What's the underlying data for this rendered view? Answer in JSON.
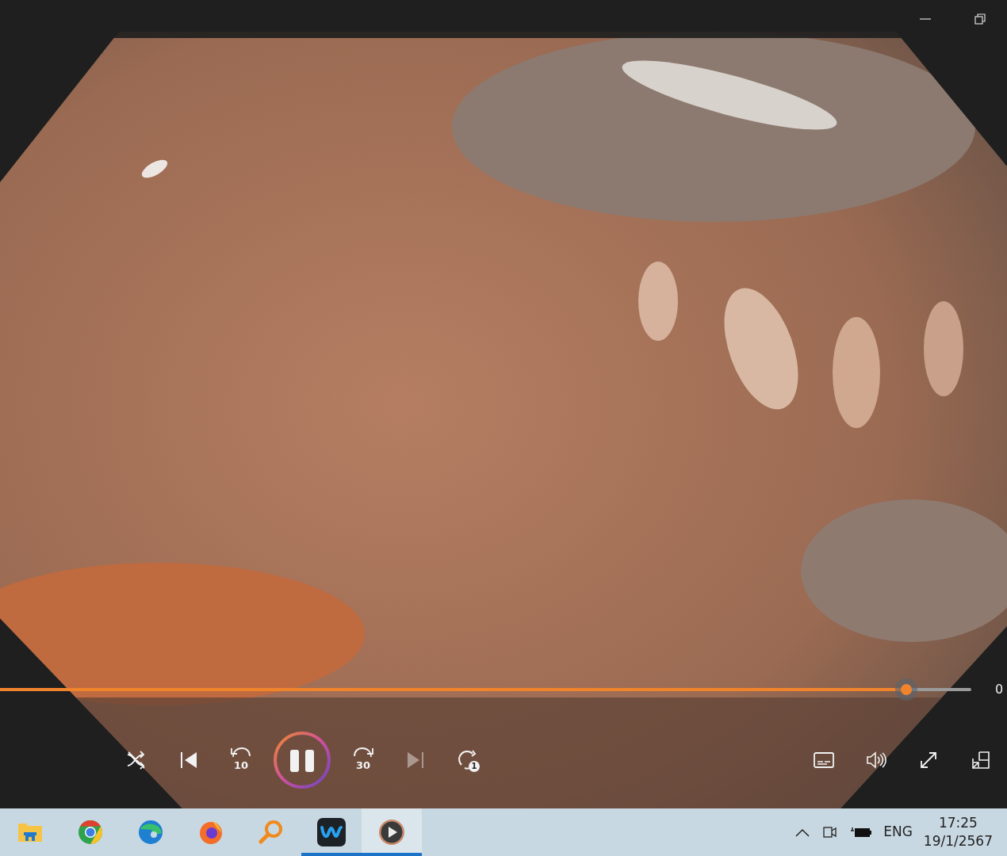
{
  "window": {
    "buttons": [
      {
        "kind": "minimize"
      },
      {
        "kind": "restore"
      }
    ]
  },
  "seek": {
    "level": 0.933,
    "time": "0"
  },
  "controls": [
    {
      "kind": "shuffle",
      "disabled": false
    },
    {
      "kind": "previous",
      "disabled": false
    },
    {
      "kind": "back",
      "label": "10",
      "disabled": false
    },
    {
      "kind": "pause",
      "disabled": false
    },
    {
      "kind": "forward",
      "label": "30",
      "disabled": false
    },
    {
      "kind": "next",
      "disabled": true
    },
    {
      "kind": "repeat",
      "label": "1",
      "disabled": false
    }
  ],
  "right_controls": [
    {
      "kind": "captions"
    },
    {
      "kind": "volume"
    },
    {
      "kind": "fullscreen"
    },
    {
      "kind": "miniplayer"
    }
  ],
  "taskbar": {
    "apps": [
      {
        "kind": "folder",
        "running": false,
        "selected": false
      },
      {
        "kind": "chrome",
        "running": false,
        "selected": false
      },
      {
        "kind": "edge",
        "running": false,
        "selected": false
      },
      {
        "kind": "firefox",
        "running": false,
        "selected": false
      },
      {
        "kind": "magnifier",
        "running": false,
        "selected": false
      },
      {
        "kind": "webex",
        "running": true,
        "selected": false
      },
      {
        "kind": "player",
        "running": true,
        "selected": true
      }
    ],
    "tray": {
      "language": "ENG",
      "time": "17:25",
      "date": "19/1/2567"
    }
  }
}
